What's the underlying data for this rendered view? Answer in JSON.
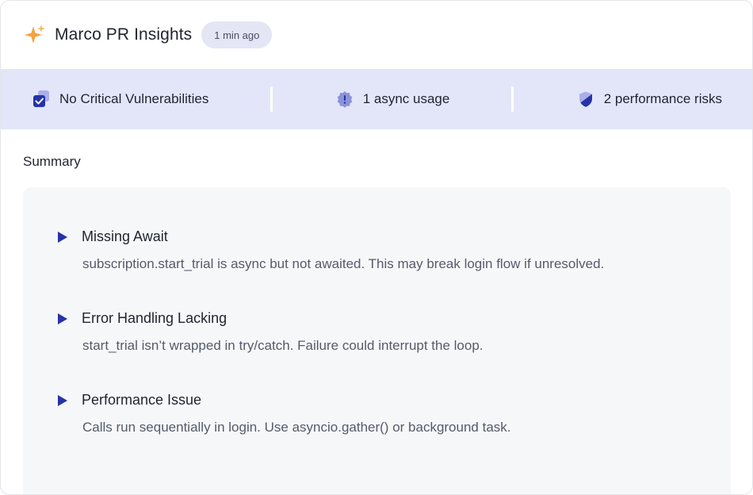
{
  "header": {
    "title": "Marco PR Insights",
    "time_badge": "1 min ago"
  },
  "stats": [
    {
      "icon": "checkbox-stack-icon",
      "label": "No Critical Vulnerabilities"
    },
    {
      "icon": "alert-badge-icon",
      "label": "1 async usage"
    },
    {
      "icon": "shield-icon",
      "label": "2 performance risks"
    }
  ],
  "summary": {
    "label": "Summary",
    "items": [
      {
        "title": "Missing Await",
        "description": "subscription.start_trial is async but not awaited. This may break login flow if unresolved."
      },
      {
        "title": "Error Handling Lacking",
        "description": "start_trial isn’t wrapped in try/catch. Failure could interrupt the loop."
      },
      {
        "title": "Performance Issue",
        "description": "Calls run sequentially in login. Use asyncio.gather() or background task."
      }
    ]
  },
  "colors": {
    "accent": "#2633a8",
    "stats_bg": "#e3e6f8",
    "badge_bg": "#e4e6f6",
    "spark": "#f4a340"
  }
}
